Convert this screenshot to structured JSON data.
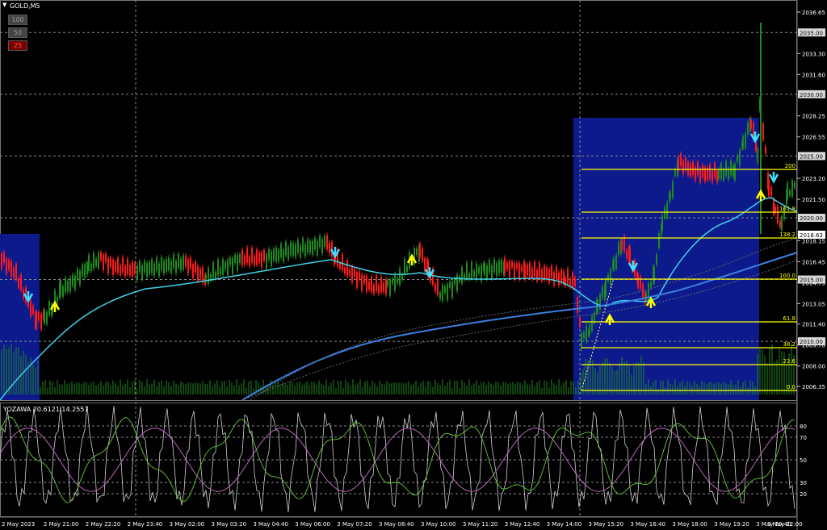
{
  "window": {
    "symbol_label": "GOLD,M5"
  },
  "zoom_buttons": [
    {
      "label": "100",
      "active": false
    },
    {
      "label": "50",
      "active": false
    },
    {
      "label": "25",
      "active": true
    }
  ],
  "indicator": {
    "label": "YOZAWA 20.6121 14.2557",
    "levels": [
      "80",
      "70",
      "50",
      "30",
      "20"
    ]
  },
  "price_axis": {
    "ticks": [
      "2036.65",
      "2033.30",
      "2031.60",
      "2028.25",
      "2026.55",
      "2023.20",
      "2021.50",
      "2018.15",
      "2016.45",
      "2014.75",
      "2013.05",
      "2011.40",
      "2009.70",
      "2008.00",
      "2006.35"
    ],
    "highlighted": [
      "2035.00",
      "2030.00",
      "2025.00",
      "2020.00",
      "2015.00",
      "2010.00"
    ],
    "current_price": "2018.63"
  },
  "time_axis": {
    "labels": [
      "2 May 2023",
      "2 May 21:00",
      "2 May 22:20",
      "2 May 23:40",
      "3 May 02:00",
      "3 May 03:20",
      "3 May 04:40",
      "3 May 06:00",
      "3 May 07:20",
      "3 May 08:40",
      "3 May 10:00",
      "3 May 11:20",
      "3 May 12:40",
      "3 May 14:00",
      "3 May 15:20",
      "3 May 16:40",
      "3 May 18:00",
      "3 May 19:20",
      "3 May 20:40",
      "3 May 22:00"
    ]
  },
  "fibonacci": [
    "0.0",
    "23.6",
    "38.2",
    "61.8",
    "100.0",
    "138.2",
    "161.8",
    "200"
  ],
  "colors": {
    "background": "#000000",
    "bull": "#1f8a1f",
    "bear": "#ff1a1a",
    "ma_fast": "#3fd0e8",
    "ma_slow": "#3a7fe0",
    "zone": "#0d1a8c",
    "fib": "#ffff00",
    "arrow_sell": "#40e0ff",
    "arrow_buy": "#ffff00"
  }
}
